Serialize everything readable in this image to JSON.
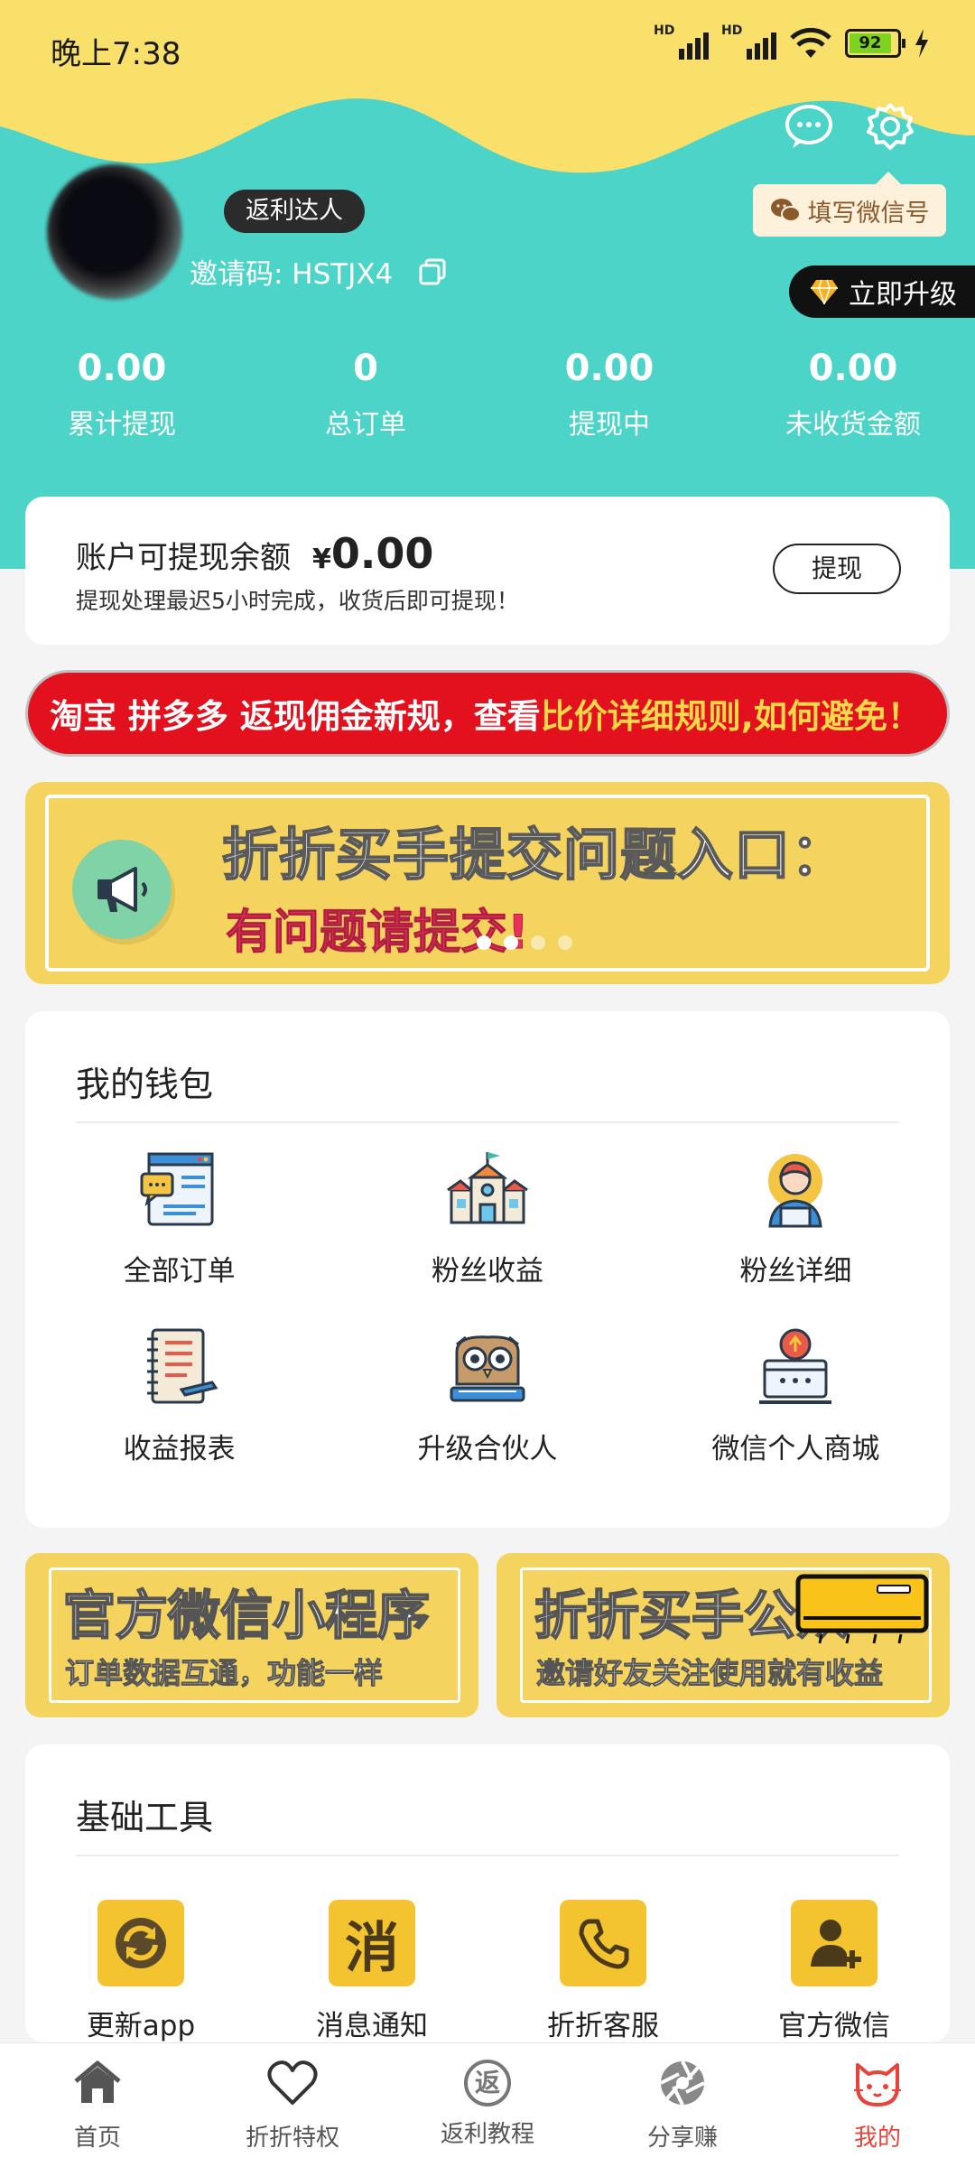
{
  "status": {
    "time": "晚上7:38",
    "sig1": "HD",
    "sig2": "HD",
    "battery": "92"
  },
  "header": {
    "wechat_button": "填写微信号",
    "upgrade_button": "立即升级",
    "badge": "返利达人",
    "invite_label": "邀请码: HSTJX4"
  },
  "stats": [
    {
      "value": "0.00",
      "label": "累计提现"
    },
    {
      "value": "0",
      "label": "总订单"
    },
    {
      "value": "0.00",
      "label": "提现中"
    },
    {
      "value": "0.00",
      "label": "未收货金额"
    }
  ],
  "balance": {
    "title": "账户可提现余额",
    "currency": "¥",
    "amount": "0.00",
    "note": "提现处理最迟5小时完成，收货后即可提现！",
    "withdraw_button": "提现"
  },
  "red_banner": {
    "part1": "淘宝 拼多多 返现佣金新规，查看",
    "part2": "比价详细规则,如何避免！"
  },
  "yellow_banner": {
    "title": "折折买手提交问题入口：",
    "subtitle": "有问题请提交!"
  },
  "wallet": {
    "title": "我的钱包",
    "items": [
      {
        "label": "全部订单",
        "icon": "orders-icon"
      },
      {
        "label": "粉丝收益",
        "icon": "school-icon"
      },
      {
        "label": "粉丝详细",
        "icon": "person-icon"
      },
      {
        "label": "收益报表",
        "icon": "notebook-icon"
      },
      {
        "label": "升级合伙人",
        "icon": "owl-icon"
      },
      {
        "label": "微信个人商城",
        "icon": "shop-icon"
      }
    ]
  },
  "promos": [
    {
      "title": "官方微信小程序",
      "sub": "订单数据互通，功能一样"
    },
    {
      "title": "折折买手公众",
      "sub": "邀请好友关注使用就有收益"
    }
  ],
  "tools": {
    "title": "基础工具",
    "items": [
      {
        "label": "更新app",
        "icon": "refresh-icon"
      },
      {
        "label": "消息通知",
        "icon": "message-icon",
        "glyph": "消"
      },
      {
        "label": "折折客服",
        "icon": "phone-icon"
      },
      {
        "label": "官方微信",
        "icon": "add-user-icon"
      }
    ]
  },
  "nav": [
    {
      "label": "首页",
      "icon": "home-icon"
    },
    {
      "label": "折折特权",
      "icon": "heart-icon"
    },
    {
      "label": "返利教程",
      "icon": "rebate-icon",
      "glyph": "返"
    },
    {
      "label": "分享赚",
      "icon": "aperture-icon"
    },
    {
      "label": "我的",
      "icon": "cat-icon"
    }
  ],
  "colors": {
    "teal": "#4dd4c8",
    "yellow": "#f9e06b",
    "accent": "#e8433a",
    "banner_red": "#e3101e"
  }
}
